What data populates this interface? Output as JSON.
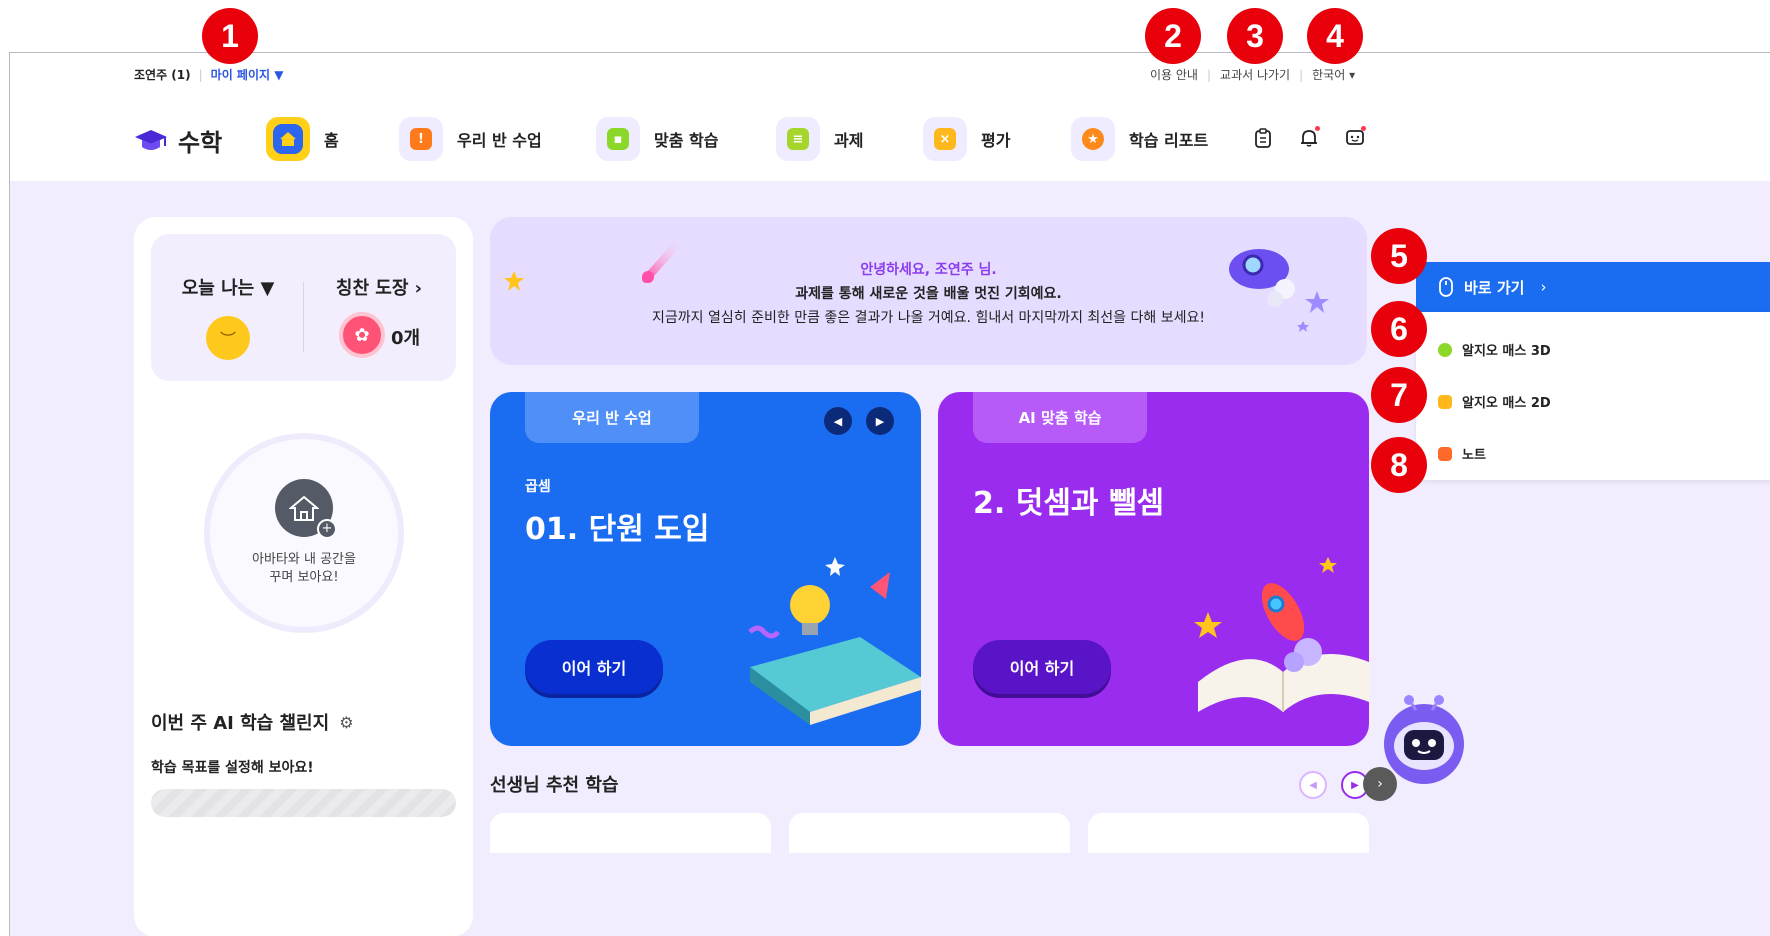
{
  "markers": [
    "1",
    "2",
    "3",
    "4",
    "5",
    "6",
    "7",
    "8"
  ],
  "utility": {
    "user": "조연주 (1)",
    "mypage": "마이 페이지 ▼",
    "guide": "이용 안내",
    "exit": "교과서 나가기",
    "language": "한국어 ▾"
  },
  "nav": {
    "subject": "수학",
    "items": [
      {
        "label": "홈",
        "icon": "home-icon"
      },
      {
        "label": "우리 반 수업",
        "icon": "class-icon"
      },
      {
        "label": "맞춤 학습",
        "icon": "custom-learning-icon"
      },
      {
        "label": "과제",
        "icon": "assignment-icon"
      },
      {
        "label": "평가",
        "icon": "assessment-icon"
      },
      {
        "label": "학습 리포트",
        "icon": "report-icon"
      }
    ],
    "right_icons": [
      "clipboard-icon",
      "bell-icon",
      "message-icon"
    ]
  },
  "mood": {
    "today_label": "오늘 나는 ▼",
    "praise_label": "칭찬 도장 ›",
    "praise_count": "0개"
  },
  "avatar": {
    "line1": "아바타와 내 공간을",
    "line2": "꾸며 보아요!"
  },
  "challenge": {
    "title": "이번 주 AI 학습 챌린지",
    "subtitle": "학습 목표를 설정해 보아요!"
  },
  "banner": {
    "greeting": "안녕하세요, 조연주 님.",
    "line2": "과제를 통해 새로운 것을 배울 멋진 기회예요.",
    "line3": "지금까지 열심히 준비한 만큼 좋은 결과가 나올 거예요. 힘내서 마지막까지 최선을 다해 보세요!"
  },
  "cards": {
    "class": {
      "tab": "우리 반 수업",
      "subtitle": "곱셈",
      "title": "01. 단원 도입",
      "cta": "이어 하기"
    },
    "ai": {
      "tab": "AI 맞춤 학습",
      "title": "2. 덧셈과 뺄셈",
      "cta": "이어 하기"
    }
  },
  "recommended": {
    "title": "선생님 추천 학습"
  },
  "quick": {
    "head": "바로 가기",
    "items": [
      "알지오 매스 3D",
      "알지오 매스 2D",
      "노트"
    ]
  },
  "colors": {
    "primary_blue": "#1a6cf0",
    "primary_purple": "#9a2cf0",
    "background": "#f1edff",
    "marker_red": "#e8000b"
  }
}
